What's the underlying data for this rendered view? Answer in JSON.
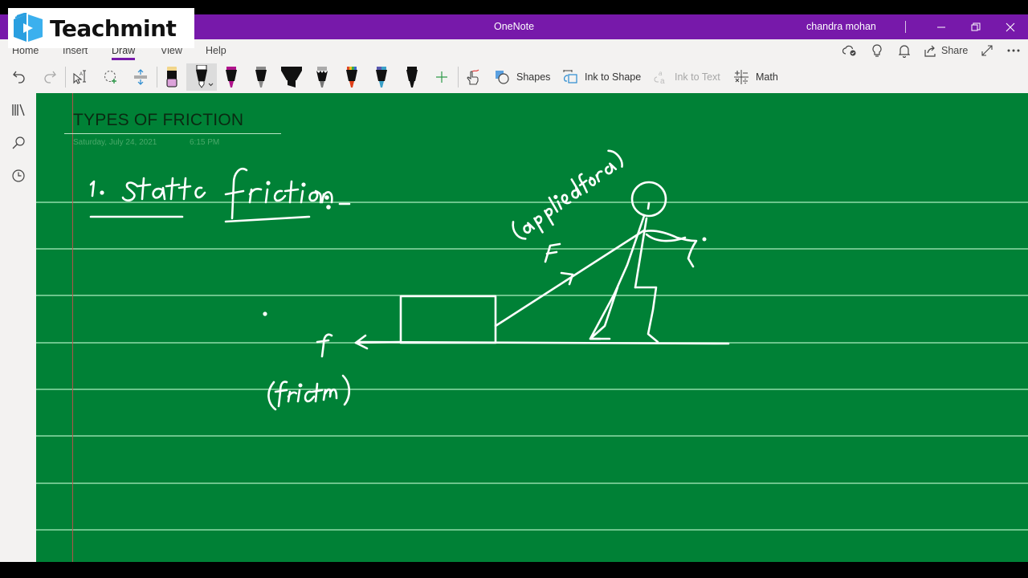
{
  "window": {
    "app_title": "OneNote",
    "user_name": "chandra mohan",
    "controls": [
      "minimize",
      "restore",
      "close"
    ]
  },
  "watermark": {
    "brand": "Teachmint"
  },
  "ribbon": {
    "tabs": [
      {
        "label": "Home",
        "active": false
      },
      {
        "label": "Insert",
        "active": false
      },
      {
        "label": "Draw",
        "active": true
      },
      {
        "label": "View",
        "active": false
      },
      {
        "label": "Help",
        "active": false
      }
    ],
    "right": {
      "share_label": "Share"
    },
    "tools": {
      "shapes_label": "Shapes",
      "ink_to_shape_label": "Ink to Shape",
      "ink_to_text_label": "Ink to Text",
      "math_label": "Math"
    },
    "pens": [
      {
        "name": "eraser",
        "color": "#e8b4e0"
      },
      {
        "name": "pen-white",
        "color": "#ffffff",
        "selected": true
      },
      {
        "name": "pen-magenta",
        "color": "#b0148c"
      },
      {
        "name": "pen-gray",
        "color": "#8a8a8a"
      },
      {
        "name": "highlighter-black",
        "color": "#111111"
      },
      {
        "name": "pen-galaxy",
        "color": "#9a9a9a"
      },
      {
        "name": "pen-rainbow",
        "color": "#e0401a"
      },
      {
        "name": "pen-ocean",
        "color": "#3aa0c8"
      },
      {
        "name": "pen-black",
        "color": "#111111"
      }
    ]
  },
  "page": {
    "title": "TYPES OF FRICTION",
    "date": "Saturday, July 24, 2021",
    "time": "6:15 PM",
    "background_color": "#008136",
    "ink_notes": {
      "heading": "1. Static friction :-",
      "applied_force_label": "(applied force)",
      "force_symbol": "F",
      "friction_symbol": "f",
      "friction_label": "(friction)"
    }
  },
  "colors": {
    "title_bar": "#7719aa",
    "ribbon": "#f3f2f1",
    "page": "#008136",
    "rule_lines": "#7fd19b",
    "margin_line": "#c0504d",
    "ink": "#ffffff"
  }
}
